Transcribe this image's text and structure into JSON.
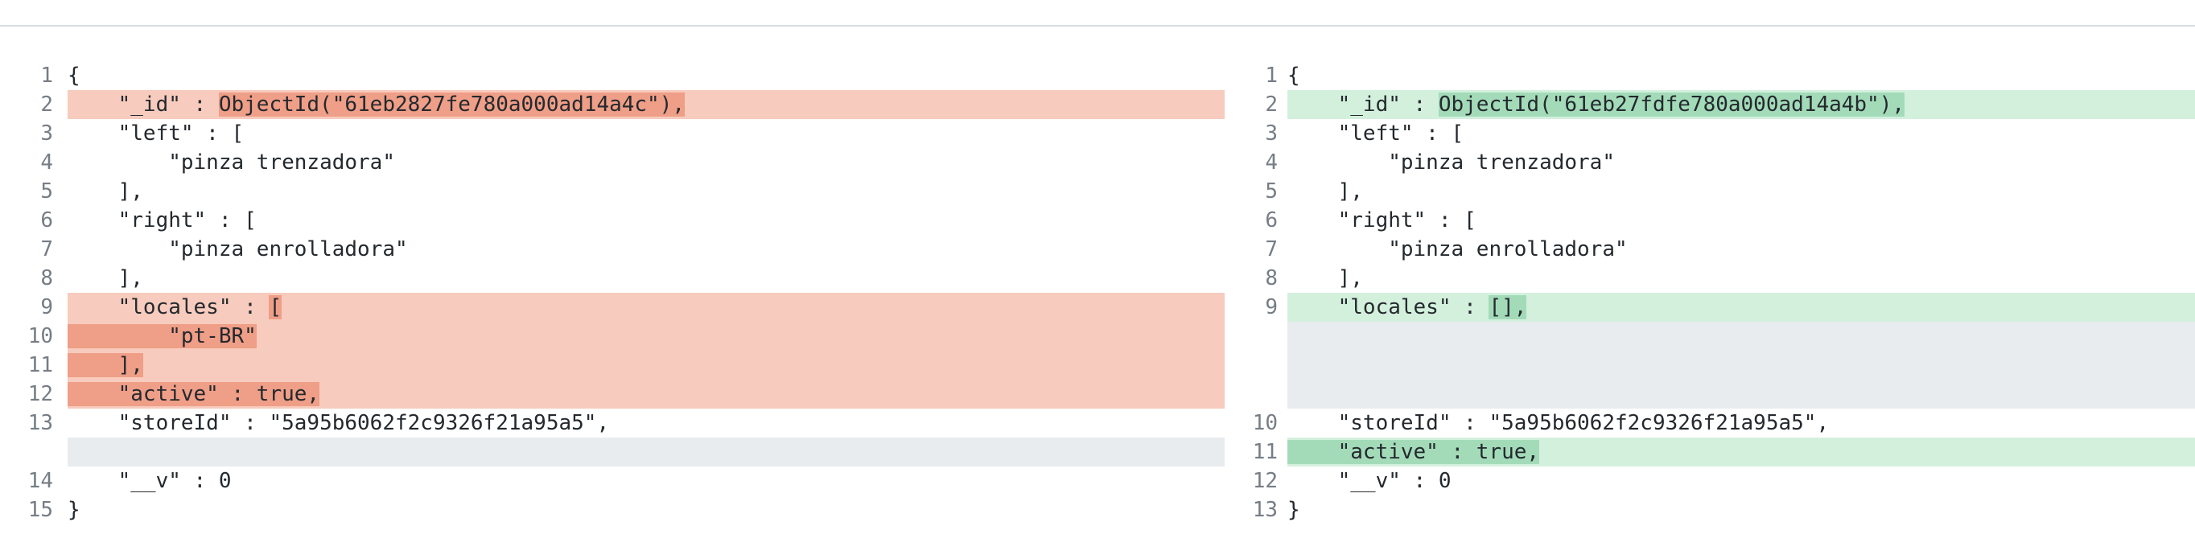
{
  "diff": {
    "left": [
      {
        "num": "1",
        "kind": "normal",
        "pre": "{",
        "hl": "",
        "post": ""
      },
      {
        "num": "2",
        "kind": "del",
        "pre": "    \"_id\" : ",
        "hl": "ObjectId(\"61eb2827fe780a000ad14a4c\"),",
        "post": ""
      },
      {
        "num": "3",
        "kind": "normal",
        "pre": "    \"left\" : [",
        "hl": "",
        "post": ""
      },
      {
        "num": "4",
        "kind": "normal",
        "pre": "        \"pinza trenzadora\"",
        "hl": "",
        "post": ""
      },
      {
        "num": "5",
        "kind": "normal",
        "pre": "    ],",
        "hl": "",
        "post": ""
      },
      {
        "num": "6",
        "kind": "normal",
        "pre": "    \"right\" : [",
        "hl": "",
        "post": ""
      },
      {
        "num": "7",
        "kind": "normal",
        "pre": "        \"pinza enrolladora\"",
        "hl": "",
        "post": ""
      },
      {
        "num": "8",
        "kind": "normal",
        "pre": "    ],",
        "hl": "",
        "post": ""
      },
      {
        "num": "9",
        "kind": "del",
        "pre": "    \"locales\" : ",
        "hl": "[",
        "post": ""
      },
      {
        "num": "10",
        "kind": "del",
        "pre": "",
        "hl": "        \"pt-BR\"",
        "post": ""
      },
      {
        "num": "11",
        "kind": "del",
        "pre": "",
        "hl": "    ],",
        "post": ""
      },
      {
        "num": "12",
        "kind": "del",
        "pre": "",
        "hl": "    \"active\" : true,",
        "post": ""
      },
      {
        "num": "13",
        "kind": "normal",
        "pre": "    \"storeId\" : \"5a95b6062f2c9326f21a95a5\",",
        "hl": "",
        "post": ""
      },
      {
        "num": "",
        "kind": "empty",
        "pre": "",
        "hl": "",
        "post": ""
      },
      {
        "num": "14",
        "kind": "normal",
        "pre": "    \"__v\" : 0",
        "hl": "",
        "post": ""
      },
      {
        "num": "15",
        "kind": "normal",
        "pre": "}",
        "hl": "",
        "post": ""
      }
    ],
    "right": [
      {
        "num": "1",
        "kind": "normal",
        "pre": "{",
        "hl": "",
        "post": ""
      },
      {
        "num": "2",
        "kind": "add",
        "pre": "    \"_id\" : ",
        "hl": "ObjectId(\"61eb27fdfe780a000ad14a4b\"),",
        "post": ""
      },
      {
        "num": "3",
        "kind": "normal",
        "pre": "    \"left\" : [",
        "hl": "",
        "post": ""
      },
      {
        "num": "4",
        "kind": "normal",
        "pre": "        \"pinza trenzadora\"",
        "hl": "",
        "post": ""
      },
      {
        "num": "5",
        "kind": "normal",
        "pre": "    ],",
        "hl": "",
        "post": ""
      },
      {
        "num": "6",
        "kind": "normal",
        "pre": "    \"right\" : [",
        "hl": "",
        "post": ""
      },
      {
        "num": "7",
        "kind": "normal",
        "pre": "        \"pinza enrolladora\"",
        "hl": "",
        "post": ""
      },
      {
        "num": "8",
        "kind": "normal",
        "pre": "    ],",
        "hl": "",
        "post": ""
      },
      {
        "num": "9",
        "kind": "add",
        "pre": "    \"locales\" : ",
        "hl": "[],",
        "post": ""
      },
      {
        "num": "",
        "kind": "empty",
        "pre": "",
        "hl": "",
        "post": ""
      },
      {
        "num": "",
        "kind": "empty",
        "pre": "",
        "hl": "",
        "post": ""
      },
      {
        "num": "",
        "kind": "empty",
        "pre": "",
        "hl": "",
        "post": ""
      },
      {
        "num": "10",
        "kind": "normal",
        "pre": "    \"storeId\" : \"5a95b6062f2c9326f21a95a5\",",
        "hl": "",
        "post": ""
      },
      {
        "num": "11",
        "kind": "add",
        "pre": "",
        "hl": "    \"active\" : true,",
        "post": ""
      },
      {
        "num": "12",
        "kind": "normal",
        "pre": "    \"__v\" : 0",
        "hl": "",
        "post": ""
      },
      {
        "num": "13",
        "kind": "normal",
        "pre": "}",
        "hl": "",
        "post": ""
      }
    ]
  },
  "colors": {
    "deleted_line_bg": "#f7cbbd",
    "deleted_word_bg": "#ef9e87",
    "added_line_bg": "#d3f0dd",
    "added_word_bg": "#a3dbb9",
    "empty_line_bg": "#e9ecef",
    "line_number": "#767d85",
    "text": "#24292e"
  }
}
